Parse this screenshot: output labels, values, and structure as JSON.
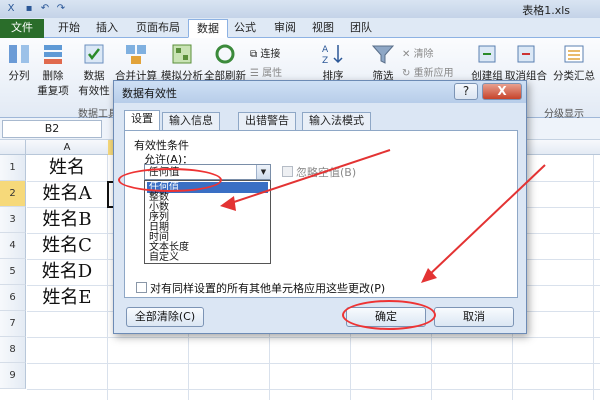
{
  "window": {
    "title": "表格1.xls"
  },
  "ribbon": {
    "tabs": [
      "文件",
      "开始",
      "插入",
      "页面布局",
      "数据",
      "公式",
      "审阅",
      "视图",
      "团队"
    ],
    "buttons": {
      "split": "分列",
      "remove_dup": "删除",
      "remove_dup_2": "重复项",
      "validate": "数据",
      "validate_2": "有效性",
      "consolidate": "合并计算",
      "whatif": "模拟分析",
      "refresh_all": "全部刷新",
      "connections": "连接",
      "properties": "属性",
      "sort": "排序",
      "filter": "筛选",
      "clear": "清除",
      "reapply": "重新应用",
      "group": "创建组",
      "ungroup": "取消组合",
      "subtotal": "分类汇总"
    },
    "group_labels": {
      "data_tools": "数据工具",
      "outline": "分级显示"
    }
  },
  "name_box": "B2",
  "columns": [
    "A",
    "B"
  ],
  "rows": [
    {
      "num": "1",
      "value": "姓名"
    },
    {
      "num": "2",
      "value": "姓名A"
    },
    {
      "num": "3",
      "value": "姓名B"
    },
    {
      "num": "4",
      "value": "姓名C"
    },
    {
      "num": "5",
      "value": "姓名D"
    },
    {
      "num": "6",
      "value": "姓名E"
    },
    {
      "num": "7",
      "value": ""
    },
    {
      "num": "8",
      "value": ""
    },
    {
      "num": "9",
      "value": ""
    }
  ],
  "dialog": {
    "title": "数据有效性",
    "help": "?",
    "close": "X",
    "tabs": [
      "设置",
      "输入信息",
      "出错警告",
      "输入法模式"
    ],
    "section_label": "有效性条件",
    "allow_label": "允许(A)：",
    "allow_value": "任何值",
    "allow_options": [
      "任何值",
      "整数",
      "小数",
      "序列",
      "日期",
      "时间",
      "文本长度",
      "自定义"
    ],
    "ignore_blank": "忽略空值(B)",
    "apply_all": "对有同样设置的所有其他单元格应用这些更改(P)",
    "clear_all": "全部清除(C)",
    "ok": "确定",
    "cancel": "取消"
  },
  "colors": {
    "file_tab": "#2a6d2a",
    "annotation": "#e33333",
    "selection": "#3a6fc4"
  }
}
